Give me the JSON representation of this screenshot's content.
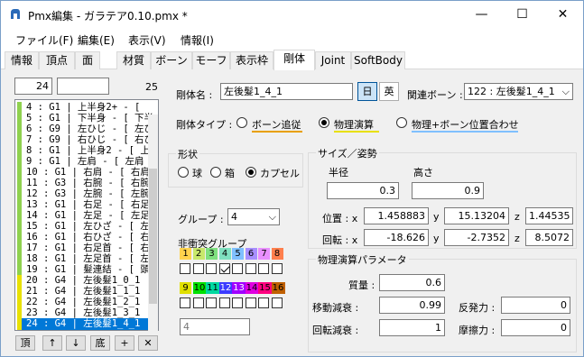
{
  "window": {
    "title": "Pmx編集 - ガラテア0.10.pmx *",
    "minimize": "—",
    "maximize": "☐",
    "close": "✕"
  },
  "menu": [
    "ファイル(F)",
    "編集(E)",
    "表示(V)",
    "情報(I)"
  ],
  "tabs": [
    "情報",
    "頂点",
    "面",
    "材質",
    "ボーン",
    "モーフ",
    "表示枠",
    "剛体",
    "Joint",
    "SoftBody"
  ],
  "active_tab": "剛体",
  "list": {
    "index_value": "24",
    "search_value": "",
    "count": "25",
    "rows": [
      {
        "text": "4 : G1 | 上半身2+ - [ ",
        "color": "#8fd14f"
      },
      {
        "text": "5 : G1 | 下半身 - [ 下半",
        "color": "#8fd14f"
      },
      {
        "text": "6 : G9 | 左ひじ - [ 左ひ",
        "color": "#8fd14f"
      },
      {
        "text": "7 : G9 | 右ひじ - [ 右ひ",
        "color": "#8fd14f"
      },
      {
        "text": "8 : G1 | 上半身2 - [ 上半",
        "color": "#8fd14f"
      },
      {
        "text": "9 : G1 | 左肩 - [ 左肩 ",
        "color": "#8fd14f"
      },
      {
        "text": "10 : G1 | 右肩 - [ 右肩",
        "color": "#8fd14f"
      },
      {
        "text": "11 : G3 | 右腕 - [ 右腕",
        "color": "#8fd14f"
      },
      {
        "text": "12 : G3 | 左腕 - [ 左腕",
        "color": "#8fd14f"
      },
      {
        "text": "13 : G1 | 右足 - [ 右足",
        "color": "#8fd14f"
      },
      {
        "text": "14 : G1 | 左足 - [ 左足",
        "color": "#8fd14f"
      },
      {
        "text": "15 : G1 | 左ひざ - [ 左ひ",
        "color": "#8fd14f"
      },
      {
        "text": "16 : G1 | 右ひざ - [ 右ひ",
        "color": "#8fd14f"
      },
      {
        "text": "17 : G1 | 右足首 - [ 右足",
        "color": "#8fd14f"
      },
      {
        "text": "18 : G1 | 左足首 - [ 左足",
        "color": "#8fd14f"
      },
      {
        "text": "19 : G1 | 髮連結 - [ 頭",
        "color": "#8fd14f"
      },
      {
        "text": "20 : G4 | 左後髮1_0_1",
        "color": "#e8e000"
      },
      {
        "text": "21 : G4 | 左後髮1_1_1",
        "color": "#e8e000"
      },
      {
        "text": "22 : G4 | 左後髮1_2_1",
        "color": "#e8e000"
      },
      {
        "text": "23 : G4 | 左後髮1_3_1",
        "color": "#e8e000"
      },
      {
        "text": "24 : G4 | 左後髮1_4_1",
        "color": "#e8e000"
      }
    ],
    "selected_index": 20,
    "buttons": [
      "頂",
      "↑",
      "↓",
      "底",
      "+",
      "✕"
    ]
  },
  "body": {
    "name_label": "剛体名 :",
    "name_value": "左後髮1_4_1",
    "jp_button": "日",
    "en_button": "英",
    "bone_label": "関連ボーン :",
    "bone_value": "122 : 左後髮1_4_1",
    "type_label": "剛体タイプ :",
    "types": [
      "ボーン追従",
      "物理演算",
      "物理+ボーン位置合わせ"
    ],
    "selected_type": 1,
    "shape_title": "形状",
    "shapes": [
      "球",
      "箱",
      "カプセル"
    ],
    "selected_shape": 2,
    "group_label": "グループ :",
    "group_value": "4",
    "collision_title": "非衝突グループ",
    "collision_row1": [
      "1",
      "2",
      "3",
      "4",
      "5",
      "6",
      "7",
      "8"
    ],
    "collision_row2": [
      "9",
      "10",
      "11",
      "12",
      "13",
      "14",
      "15",
      "16"
    ],
    "collision_colors1": [
      "#ffd34d",
      "#c8e86b",
      "#7fe07f",
      "#7fe0c0",
      "#7fc0ff",
      "#a88fff",
      "#e88fff",
      "#ff7f4d"
    ],
    "collision_colors2": [
      "#e0e000",
      "#00e000",
      "#00d8a0",
      "#3b3bff",
      "#a000ff",
      "#e000e0",
      "#ff007f",
      "#c06000"
    ],
    "collision_checked": [
      false,
      false,
      false,
      true,
      false,
      false,
      false,
      false,
      false,
      false,
      false,
      false,
      false,
      false,
      false,
      false
    ],
    "collision_text": "4",
    "size_title": "サイズ／姿勢",
    "radius_label": "半径",
    "height_label": "高さ",
    "radius_value": "0.3",
    "height_value": "0.9",
    "pos_label": "位置 : x",
    "rot_label": "回転 : x",
    "pos": {
      "x": "1.458883",
      "y": "15.13204",
      "z": "1.44535"
    },
    "rot": {
      "x": "-18.626",
      "y": "-2.7352",
      "z": "8.5072"
    },
    "y_label": "y",
    "z_label": "z",
    "phys_title": "物理演算パラメータ",
    "mass_label": "質量 :",
    "mass_value": "0.6",
    "move_damp_label": "移動減衰 :",
    "move_damp_value": "0.99",
    "restitution_label": "反発力 :",
    "restitution_value": "0",
    "rot_damp_label": "回転減衰 :",
    "rot_damp_value": "1",
    "friction_label": "摩擦力 :",
    "friction_value": "0"
  }
}
